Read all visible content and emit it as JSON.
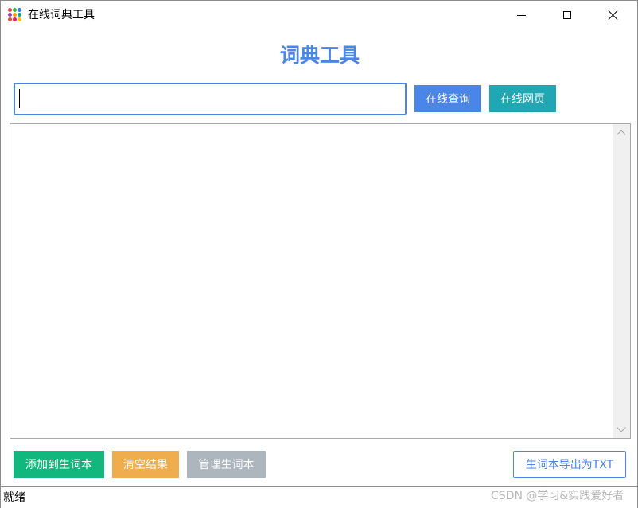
{
  "window": {
    "title": "在线词典工具",
    "app_icon": "dotted-grid-icon",
    "controls": {
      "minimize": "minimize-icon",
      "maximize": "maximize-icon",
      "close": "close-icon"
    }
  },
  "heading": "词典工具",
  "search": {
    "value": "",
    "placeholder": ""
  },
  "buttons": {
    "query": "在线查询",
    "web": "在线网页",
    "add_to_vocab": "添加到生词本",
    "clear_results": "清空结果",
    "manage_vocab": "管理生词本",
    "export_txt": "生词本导出为TXT"
  },
  "results": {
    "text": ""
  },
  "status": {
    "text": "就绪"
  },
  "watermark": "CSDN @学习&实践爱好者",
  "colors": {
    "primary": "#4a86e8",
    "teal": "#1fa7b4",
    "green": "#13b77e",
    "orange": "#f0ad4e",
    "gray": "#adb5bd"
  }
}
